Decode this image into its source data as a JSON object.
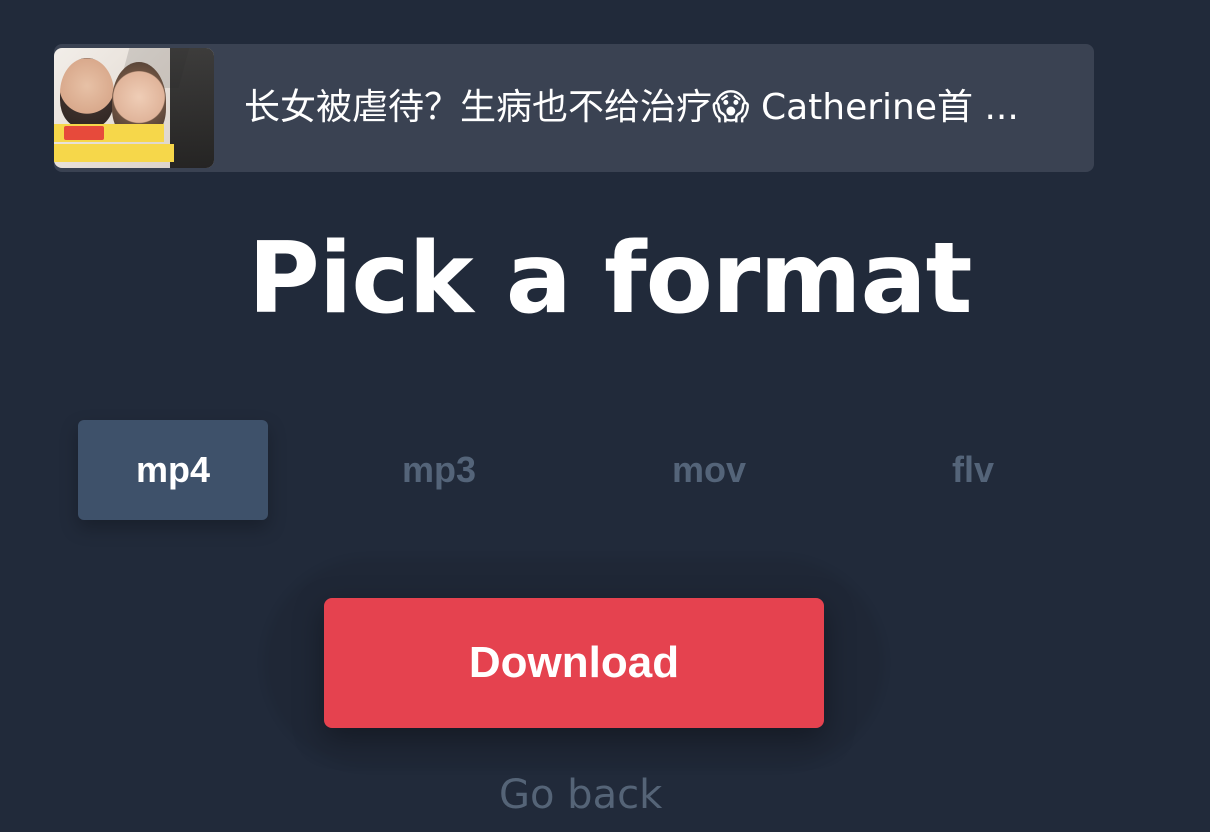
{
  "video": {
    "title": "长女被虐待？生病也不给治疗😱 Catherine首 ...",
    "thumbnail_icon": "video-thumbnail"
  },
  "heading": "Pick a format",
  "formats": [
    {
      "label": "mp4",
      "selected": true
    },
    {
      "label": "mp3",
      "selected": false
    },
    {
      "label": "mov",
      "selected": false
    },
    {
      "label": "flv",
      "selected": false
    }
  ],
  "actions": {
    "download_label": "Download",
    "go_back_label": "Go back"
  },
  "colors": {
    "background": "#212a3a",
    "card": "#3a4252",
    "tab_active": "#3e516a",
    "tab_inactive_text": "#546479",
    "download": "#e5424f",
    "go_back_text": "#556477"
  }
}
